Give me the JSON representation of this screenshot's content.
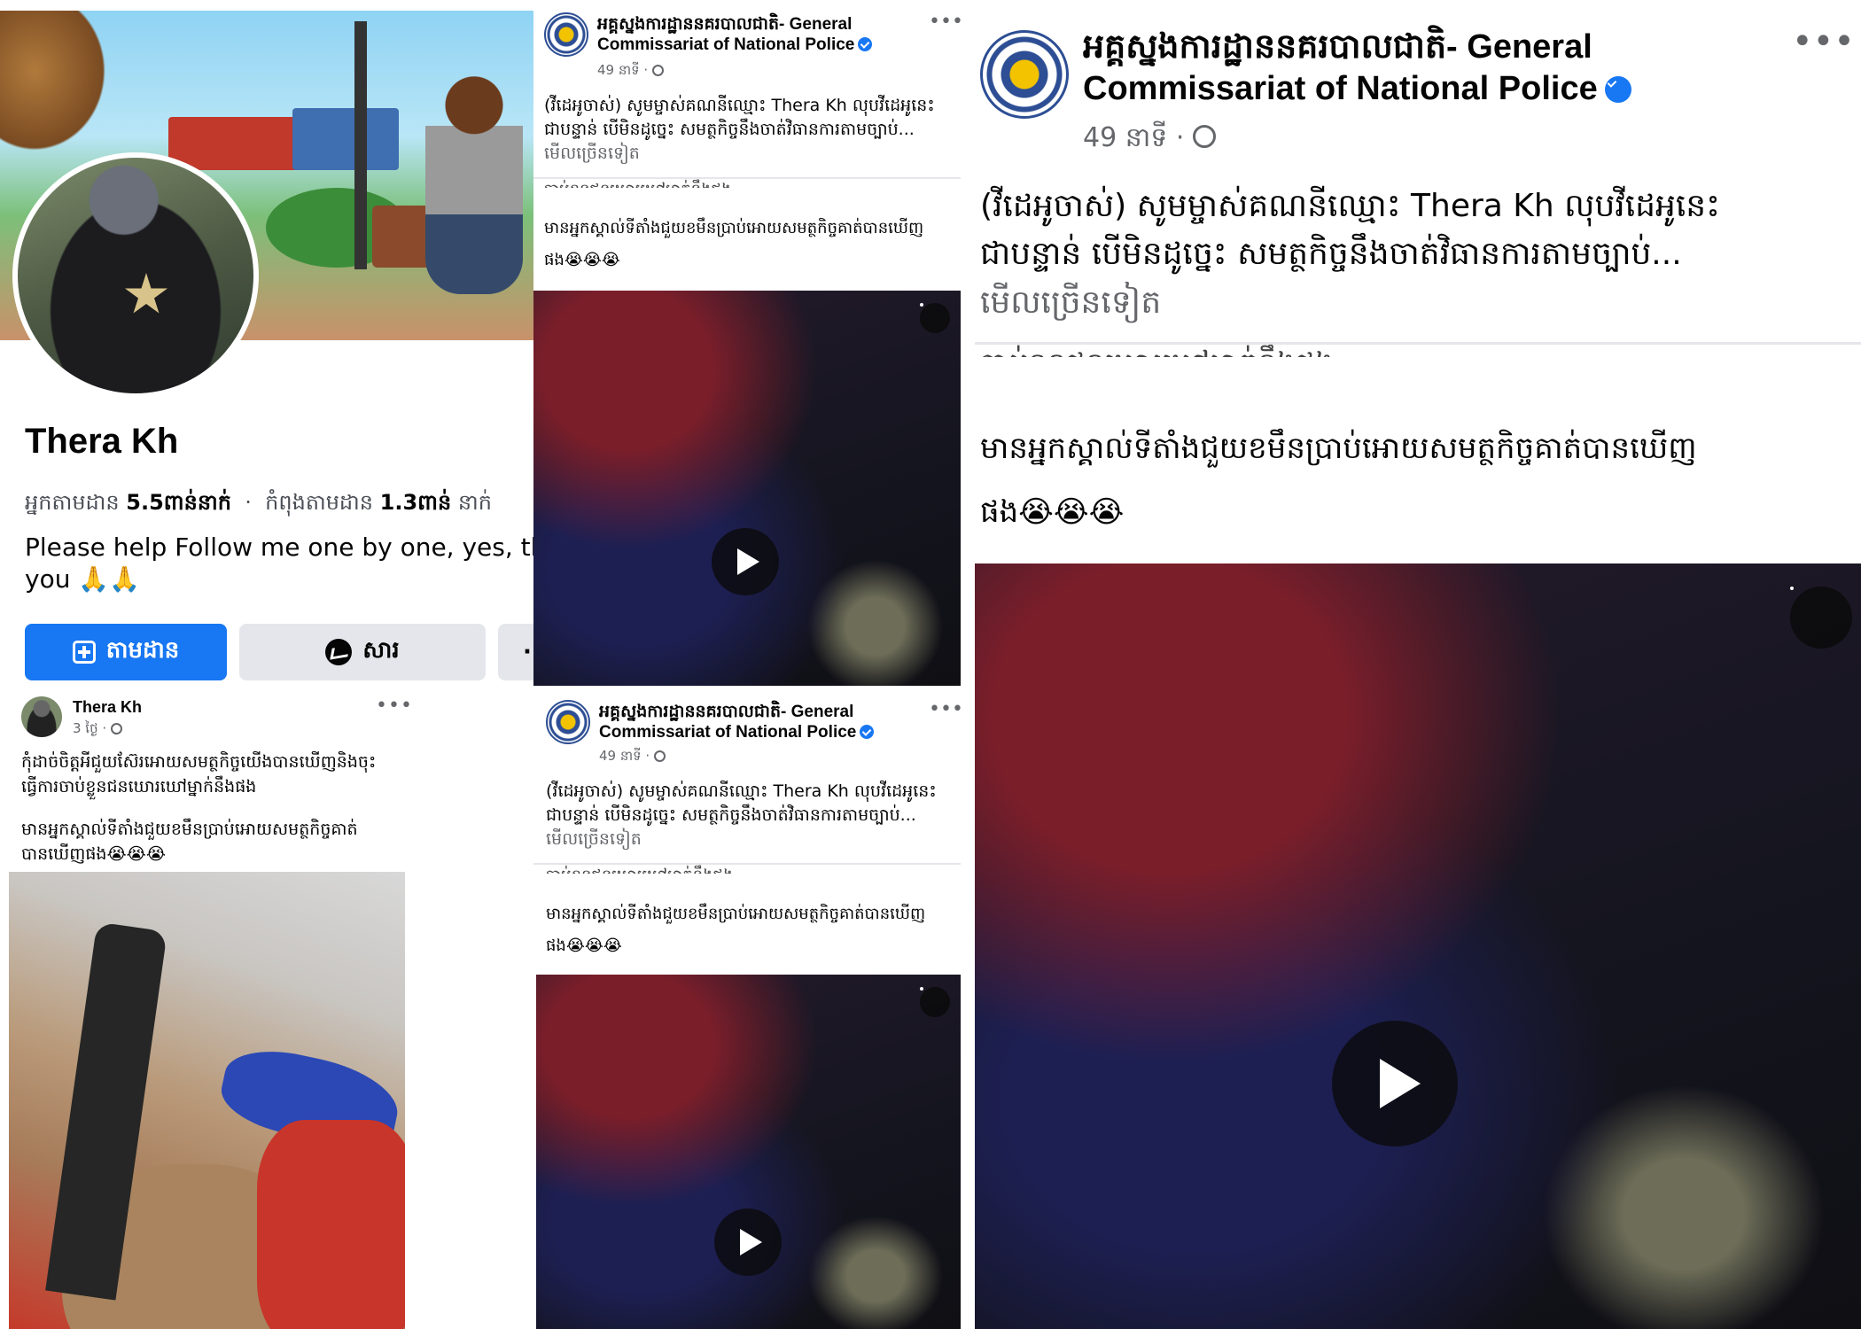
{
  "profile": {
    "name": "Thera Kh",
    "followers_label": "អ្នកតាមដាន",
    "followers_count": "5.5ពាន់នាក់",
    "dot": "·",
    "following_label": "កំពុងតាមដាន",
    "following_count": "1.3ពាន់",
    "following_unit": "នាក់",
    "bio_line1": "Please help Follow me one by one, yes, thar",
    "bio_line2": "you 🙏🙏",
    "follow_button": "តាមដាន",
    "message_button": "សារ",
    "more_button": "·",
    "post": {
      "author": "Thera Kh",
      "time": "3 ថ្ងៃ ·",
      "more": "•••",
      "text_line1": "កុំដាច់ចិត្តអីជួយស៊ែរអោយសមត្ថកិច្ចយើងបានឃើញនិងចុះ",
      "text_line2": "ធ្វើការចាប់ខ្លួនជនឃោរឃៅម្នាក់នឹងផង",
      "text_line3": "មានអ្នកស្គាល់ទីតាំងជួយខមឹនប្រាប់អោយសមត្ថកិច្ចគាត់",
      "text_line4": "បានឃើញផង😭😭😭"
    }
  },
  "police_post": {
    "page_name_line1": "អគ្គស្នងការដ្ឋាននគរបាលជាតិ- General",
    "page_name_line2": "Commissariat of National Police",
    "time": "49 នាទី ·",
    "more": "•••",
    "caption_line1": "(វីដេអូចាស់) សូមម្ចាស់គណនីឈ្មោះ Thera Kh លុបវីដេអូនេះ",
    "caption_line2": "ជាបន្ទាន់ បើមិនដូច្នេះ សមត្ថកិច្ចនឹងចាត់វិធានការតាមច្បាប់...",
    "see_more": "មើលច្រើនទៀត",
    "cut_line": "បាប់ខ្លួនជនឃោរឃៅម្នាក់នឹងផង",
    "quote_line1": "មានអ្នកស្គាល់ទីតាំងជួយខមឹនប្រាប់អោយសមត្ថកិច្ចគាត់បានឃើញ",
    "quote_line2": "ផង😭😭😭"
  },
  "icons": {
    "verified": "verified-badge-icon",
    "globe": "globe-icon",
    "play": "play-icon",
    "pip": "picture-in-picture-icon",
    "add_friend": "follow-add-icon",
    "messenger": "messenger-icon"
  },
  "colors": {
    "facebook_blue": "#1877f2",
    "secondary_text": "#65676b",
    "button_grey": "#e4e6eb"
  }
}
